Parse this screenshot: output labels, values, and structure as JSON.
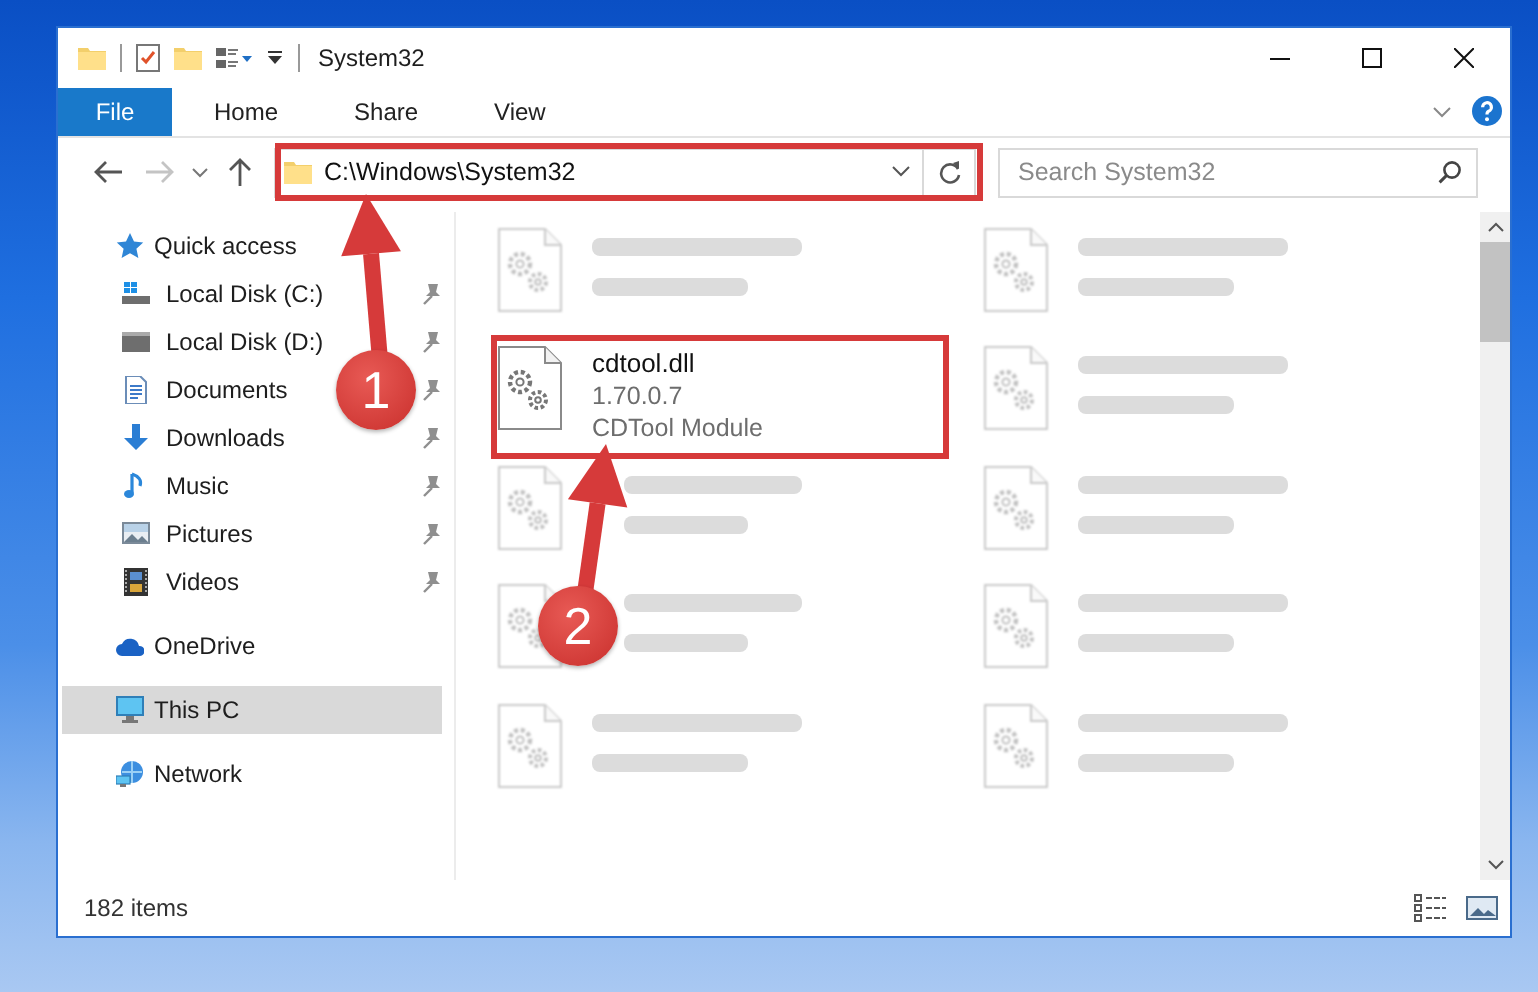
{
  "window": {
    "title": "System32"
  },
  "ribbon_tabs": [
    {
      "label": "File",
      "selected": true
    },
    {
      "label": "Home",
      "selected": false
    },
    {
      "label": "Share",
      "selected": false
    },
    {
      "label": "View",
      "selected": false
    }
  ],
  "address_bar": {
    "path": "C:\\Windows\\System32"
  },
  "search": {
    "placeholder": "Search System32"
  },
  "navigation": [
    {
      "label": "Quick access",
      "kind": "star",
      "selected": false,
      "children": [
        {
          "label": "Local Disk (C:)",
          "kind": "drive-windows",
          "pinned": true,
          "selected": false
        },
        {
          "label": "Local Disk (D:)",
          "kind": "drive",
          "pinned": true,
          "selected": false
        },
        {
          "label": "Documents",
          "kind": "documents",
          "pinned": true,
          "selected": false
        },
        {
          "label": "Downloads",
          "kind": "downloads",
          "pinned": true,
          "selected": false
        },
        {
          "label": "Music",
          "kind": "music",
          "pinned": true,
          "selected": false
        },
        {
          "label": "Pictures",
          "kind": "pictures",
          "pinned": true,
          "selected": false
        },
        {
          "label": "Videos",
          "kind": "videos",
          "pinned": true,
          "selected": false
        }
      ]
    },
    {
      "label": "OneDrive",
      "kind": "cloud",
      "selected": false
    },
    {
      "label": "This PC",
      "kind": "pc",
      "selected": true
    },
    {
      "label": "Network",
      "kind": "network",
      "selected": false
    }
  ],
  "files": [
    {
      "blurred": true
    },
    {
      "blurred": true
    },
    {
      "name": "cdtool.dll",
      "details": [
        "1.70.0.7",
        "CDTool Module"
      ],
      "blurred": false
    },
    {
      "blurred": true
    },
    {
      "blurred": true
    },
    {
      "blurred": true
    },
    {
      "blurred": true
    },
    {
      "blurred": true
    },
    {
      "blurred": true
    },
    {
      "blurred": true
    }
  ],
  "status_bar": {
    "item_count": "182 items"
  },
  "annotations": [
    {
      "label": "1"
    },
    {
      "label": "2"
    }
  ]
}
